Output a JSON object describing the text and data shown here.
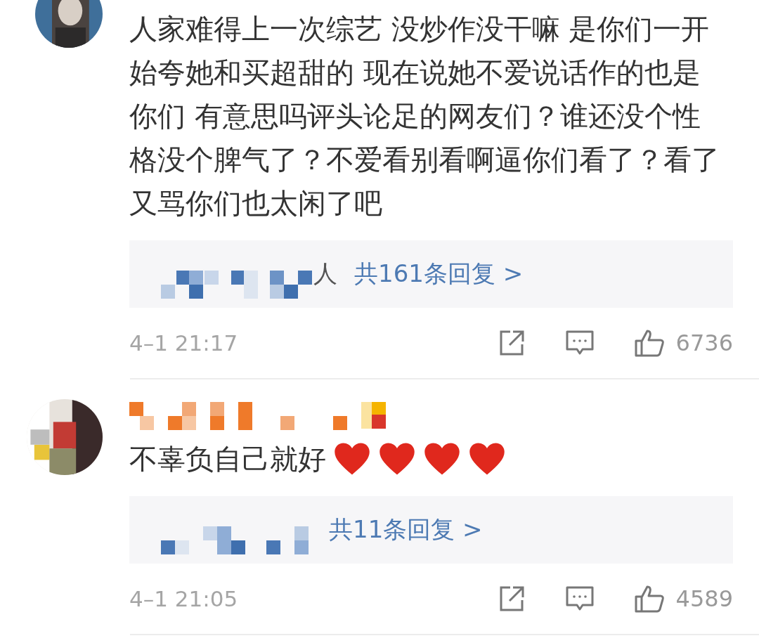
{
  "comments": [
    {
      "name_pixelated": false,
      "text": "人家难得上一次综艺 没炒作没干嘛 是你们一开始夸她和买超甜的 现在说她不爱说话作的也是你们 有意思吗评头论足的网友们？谁还没个性格没个脾气了？不爱看别看啊逼你们看了？看了又骂你们也太闲了吧",
      "replies": {
        "preview": "人",
        "count_text": "共161条回复 >"
      },
      "time": "4–1 21:17",
      "likes": "6736"
    },
    {
      "name_pixelated": true,
      "text": "不辜负自己就好",
      "emojis": [
        {
          "kind": "heart"
        },
        {
          "kind": "heart"
        },
        {
          "kind": "heart"
        },
        {
          "kind": "heart"
        }
      ],
      "replies": {
        "count_text": "共11条回复 >"
      },
      "time": "4–1 21:05",
      "likes": "4589"
    }
  ]
}
